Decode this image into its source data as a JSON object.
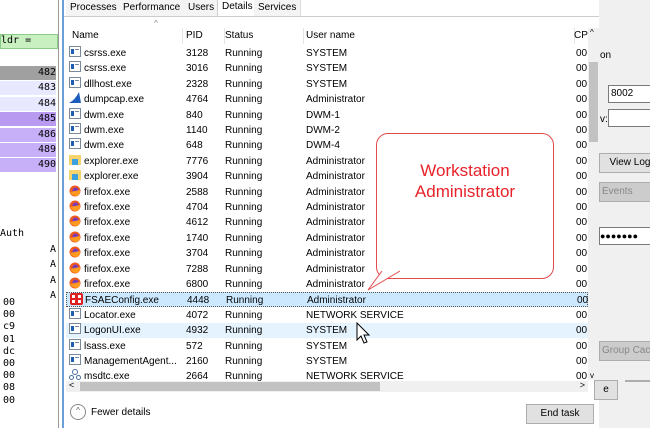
{
  "tabs": [
    "Processes",
    "Performance",
    "Users",
    "Details",
    "Services"
  ],
  "columns": {
    "name": "Name",
    "pid": "PID",
    "status": "Status",
    "user": "User name",
    "cpu": "CP"
  },
  "processes": [
    {
      "name": "csrss.exe",
      "pid": "3128",
      "status": "Running",
      "user": "SYSTEM",
      "cpu": "00",
      "icon": "app"
    },
    {
      "name": "csrss.exe",
      "pid": "3016",
      "status": "Running",
      "user": "SYSTEM",
      "cpu": "00",
      "icon": "app"
    },
    {
      "name": "dllhost.exe",
      "pid": "2328",
      "status": "Running",
      "user": "SYSTEM",
      "cpu": "00",
      "icon": "app"
    },
    {
      "name": "dumpcap.exe",
      "pid": "4764",
      "status": "Running",
      "user": "Administrator",
      "cpu": "00",
      "icon": "shark"
    },
    {
      "name": "dwm.exe",
      "pid": "840",
      "status": "Running",
      "user": "DWM-1",
      "cpu": "00",
      "icon": "app"
    },
    {
      "name": "dwm.exe",
      "pid": "1140",
      "status": "Running",
      "user": "DWM-2",
      "cpu": "00",
      "icon": "app"
    },
    {
      "name": "dwm.exe",
      "pid": "648",
      "status": "Running",
      "user": "DWM-4",
      "cpu": "00",
      "icon": "app"
    },
    {
      "name": "explorer.exe",
      "pid": "7776",
      "status": "Running",
      "user": "Administrator",
      "cpu": "00",
      "icon": "folder"
    },
    {
      "name": "explorer.exe",
      "pid": "3904",
      "status": "Running",
      "user": "Administrator",
      "cpu": "00",
      "icon": "folder"
    },
    {
      "name": "firefox.exe",
      "pid": "2588",
      "status": "Running",
      "user": "Administrator",
      "cpu": "00",
      "icon": "firefox"
    },
    {
      "name": "firefox.exe",
      "pid": "4704",
      "status": "Running",
      "user": "Administrator",
      "cpu": "00",
      "icon": "firefox"
    },
    {
      "name": "firefox.exe",
      "pid": "4612",
      "status": "Running",
      "user": "Administrator",
      "cpu": "00",
      "icon": "firefox"
    },
    {
      "name": "firefox.exe",
      "pid": "1740",
      "status": "Running",
      "user": "Administrator",
      "cpu": "00",
      "icon": "firefox"
    },
    {
      "name": "firefox.exe",
      "pid": "3704",
      "status": "Running",
      "user": "Administrator",
      "cpu": "00",
      "icon": "firefox"
    },
    {
      "name": "firefox.exe",
      "pid": "7288",
      "status": "Running",
      "user": "Administrator",
      "cpu": "00",
      "icon": "firefox"
    },
    {
      "name": "firefox.exe",
      "pid": "6800",
      "status": "Running",
      "user": "Administrator",
      "cpu": "00",
      "icon": "firefox"
    },
    {
      "name": "FSAEConfig.exe",
      "pid": "4448",
      "status": "Running",
      "user": "Administrator",
      "cpu": "00",
      "icon": "fortinet"
    },
    {
      "name": "Locator.exe",
      "pid": "4072",
      "status": "Running",
      "user": "NETWORK SERVICE",
      "cpu": "00",
      "icon": "app"
    },
    {
      "name": "LogonUI.exe",
      "pid": "4932",
      "status": "Running",
      "user": "SYSTEM",
      "cpu": "00",
      "icon": "app"
    },
    {
      "name": "lsass.exe",
      "pid": "572",
      "status": "Running",
      "user": "SYSTEM",
      "cpu": "00",
      "icon": "app"
    },
    {
      "name": "ManagementAgent...",
      "pid": "2160",
      "status": "Running",
      "user": "SYSTEM",
      "cpu": "00",
      "icon": "app"
    },
    {
      "name": "msdtc.exe",
      "pid": "2664",
      "status": "Running",
      "user": "NETWORK SERVICE",
      "cpu": "00",
      "icon": "network"
    }
  ],
  "footer": {
    "fewer_details": "Fewer details",
    "end_task": "End task"
  },
  "callout": {
    "line1": "Workstation",
    "line2": "Administrator"
  },
  "left_pane": {
    "filter": "ldr =",
    "rows": [
      "482",
      "483",
      "484",
      "485",
      "486",
      "489",
      "490"
    ],
    "auth": "Auth",
    "a": "A",
    "hex": [
      "00",
      "00",
      "c9",
      "01",
      "dc",
      "00",
      "00",
      "08",
      "00"
    ]
  },
  "right_pane": {
    "label_on": "on",
    "port": "8002",
    "label_v": "v:",
    "view_log": "View Log",
    "events": "Events",
    "password": "●●●●●●●",
    "group_cache": "Group Cache",
    "btn_e": "e"
  }
}
